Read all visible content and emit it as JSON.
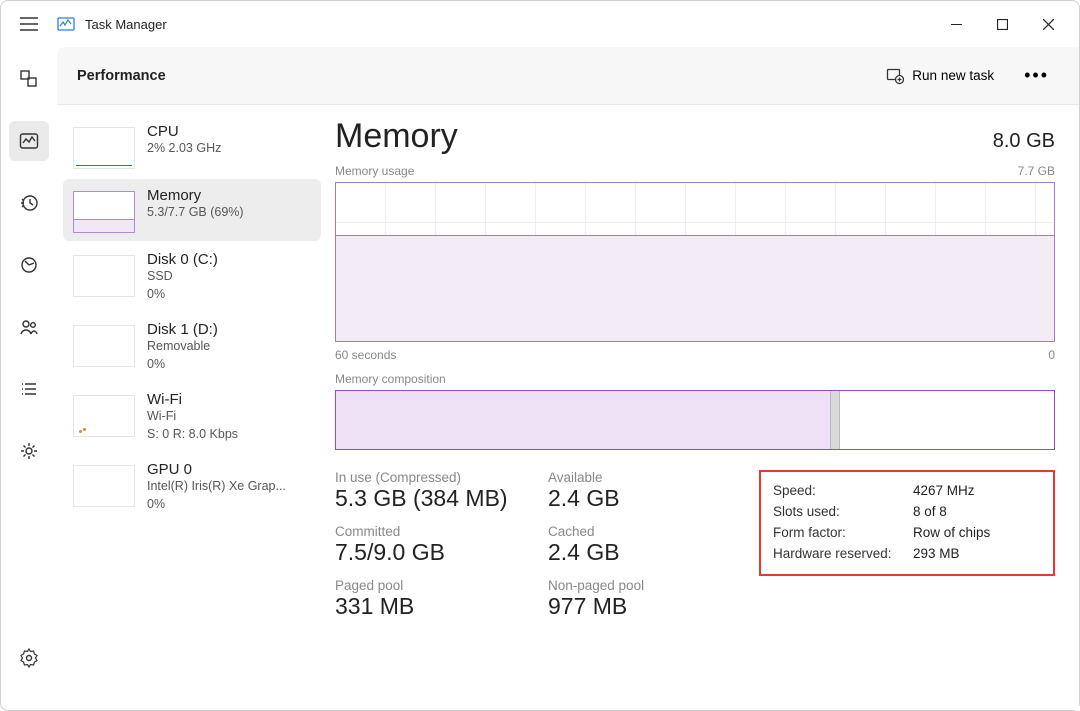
{
  "app": {
    "title": "Task Manager"
  },
  "header": {
    "title": "Performance",
    "runTask": "Run new task"
  },
  "cards": [
    {
      "title": "CPU",
      "sub1": "2%  2.03 GHz"
    },
    {
      "title": "Memory",
      "sub1": "5.3/7.7 GB (69%)"
    },
    {
      "title": "Disk 0 (C:)",
      "sub1": "SSD",
      "sub2": "0%"
    },
    {
      "title": "Disk 1 (D:)",
      "sub1": "Removable",
      "sub2": "0%"
    },
    {
      "title": "Wi-Fi",
      "sub1": "Wi-Fi",
      "sub2": "S: 0  R: 8.0 Kbps"
    },
    {
      "title": "GPU 0",
      "sub1": "Intel(R) Iris(R) Xe Grap...",
      "sub2": "0%"
    }
  ],
  "detail": {
    "title": "Memory",
    "total": "8.0 GB",
    "usageLabel": "Memory usage",
    "usageMax": "7.7 GB",
    "xLeft": "60 seconds",
    "xRight": "0",
    "compLabel": "Memory composition",
    "stats": {
      "inUseLabel": "In use (Compressed)",
      "inUse": "5.3 GB (384 MB)",
      "availableLabel": "Available",
      "available": "2.4 GB",
      "committedLabel": "Committed",
      "committed": "7.5/9.0 GB",
      "cachedLabel": "Cached",
      "cached": "2.4 GB",
      "pagedLabel": "Paged pool",
      "paged": "331 MB",
      "nonPagedLabel": "Non-paged pool",
      "nonPaged": "977 MB"
    },
    "info": {
      "speedLabel": "Speed:",
      "speed": "4267 MHz",
      "slotsLabel": "Slots used:",
      "slots": "8 of 8",
      "formLabel": "Form factor:",
      "form": "Row of chips",
      "reservedLabel": "Hardware reserved:",
      "reserved": "293 MB"
    }
  }
}
